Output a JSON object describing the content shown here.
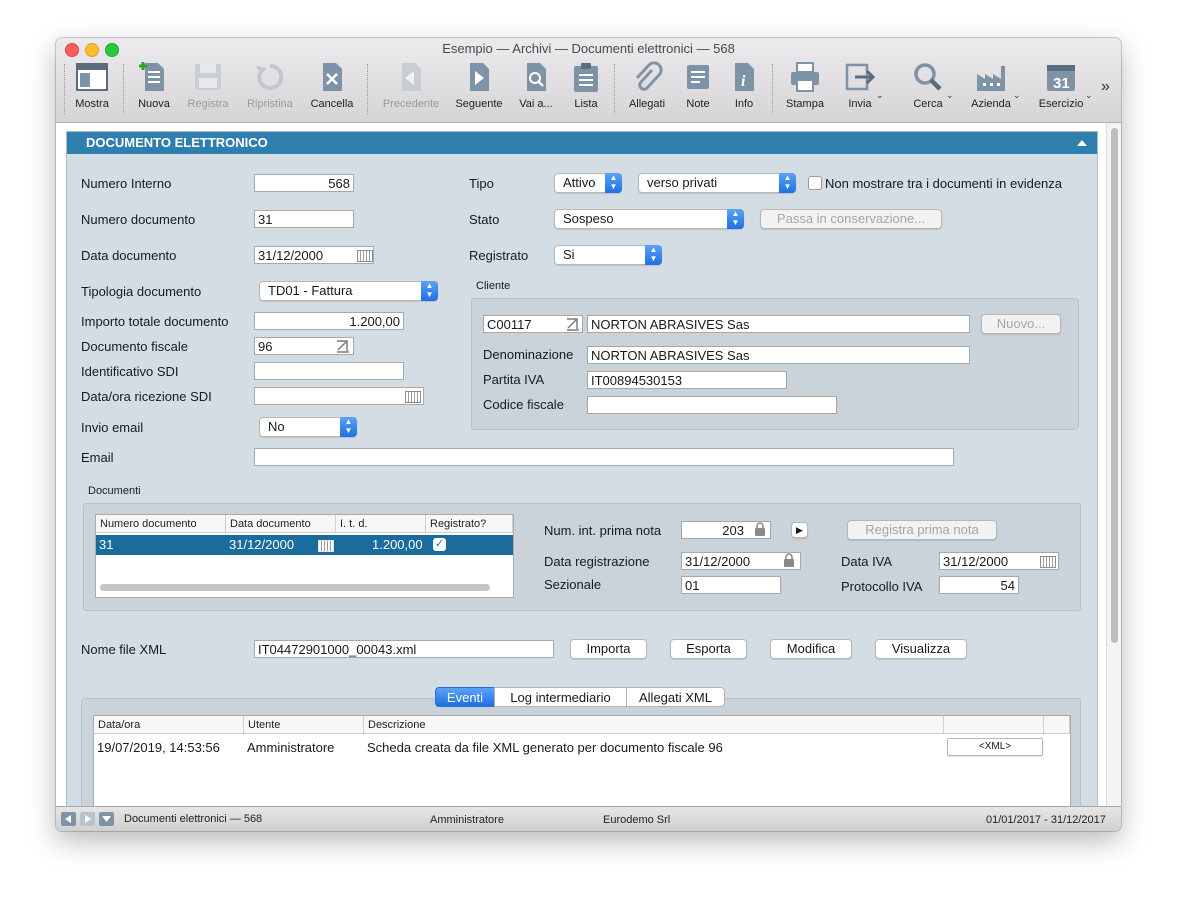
{
  "window": {
    "title": "Esempio — Archivi — Documenti elettronici — 568"
  },
  "toolbar": {
    "mostra": "Mostra",
    "nuova": "Nuova",
    "registra": "Registra",
    "ripristina": "Ripristina",
    "cancella": "Cancella",
    "precedente": "Precedente",
    "seguente": "Seguente",
    "vai": "Vai a...",
    "lista": "Lista",
    "allegati": "Allegati",
    "note": "Note",
    "info": "Info",
    "stampa": "Stampa",
    "invia": "Invia",
    "cerca": "Cerca",
    "azienda": "Azienda",
    "esercizio": "Esercizio",
    "esercizio_day": "31",
    "more": "»"
  },
  "section": {
    "title": "DOCUMENTO ELETTRONICO"
  },
  "form": {
    "numero_interno_label": "Numero Interno",
    "numero_interno": "568",
    "numero_documento_label": "Numero documento",
    "numero_documento": "31",
    "data_documento_label": "Data documento",
    "data_documento": "31/12/2000",
    "tipologia_label": "Tipologia documento",
    "tipologia": "TD01 - Fattura",
    "importo_label": "Importo totale documento",
    "importo": "1.200,00",
    "doc_fiscale_label": "Documento fiscale",
    "doc_fiscale": "96",
    "id_sdi_label": "Identificativo SDI",
    "id_sdi": "",
    "ricezione_sdi_label": "Data/ora ricezione SDI",
    "ricezione_sdi": "",
    "invio_email_label": "Invio email",
    "invio_email": "No",
    "email_label": "Email",
    "email": "",
    "tipo_label": "Tipo",
    "tipo": "Attivo",
    "tipo_dest": "verso privati",
    "non_mostrare_label": "Non mostrare tra i documenti in evidenza",
    "stato_label": "Stato",
    "stato": "Sospeso",
    "conservazione_button": "Passa in conservazione...",
    "registrato_label": "Registrato",
    "registrato": "Si"
  },
  "cliente": {
    "group_label": "Cliente",
    "codice": "C00117",
    "nome": "NORTON ABRASIVES Sas",
    "nuovo_button": "Nuovo...",
    "denominazione_label": "Denominazione",
    "denominazione": "NORTON ABRASIVES Sas",
    "piva_label": "Partita IVA",
    "piva": "IT00894530153",
    "cf_label": "Codice fiscale",
    "cf": ""
  },
  "documenti": {
    "group_label": "Documenti",
    "columns": [
      "Numero documento",
      "Data documento",
      "I. t. d.",
      "Registrato?"
    ],
    "rows": [
      {
        "numero": "31",
        "data": "31/12/2000",
        "importo": "1.200,00",
        "registrato": "✓"
      }
    ]
  },
  "prima_nota": {
    "num_label": "Num. int. prima nota",
    "num": "203",
    "play": "▶",
    "registra_button": "Registra prima nota",
    "data_reg_label": "Data registrazione",
    "data_reg": "31/12/2000",
    "data_iva_label": "Data IVA",
    "data_iva": "31/12/2000",
    "sezionale_label": "Sezionale",
    "sezionale": "01",
    "protocollo_label": "Protocollo IVA",
    "protocollo": "54"
  },
  "xml": {
    "label": "Nome file XML",
    "filename": "IT04472901000_00043.xml",
    "importa": "Importa",
    "esporta": "Esporta",
    "modifica": "Modifica",
    "visualizza": "Visualizza"
  },
  "tabs": [
    "Eventi",
    "Log intermediario",
    "Allegati XML"
  ],
  "eventi": {
    "columns": [
      "Data/ora",
      "Utente",
      "Descrizione"
    ],
    "rows": [
      {
        "data": "19/07/2019, 14:53:56",
        "utente": "Amministratore",
        "descrizione": "Scheda creata da file XML generato per documento fiscale 96",
        "xml_button": "<XML>"
      }
    ]
  },
  "status": {
    "left": "Documenti elettronici — 568",
    "user": "Amministratore",
    "company": "Eurodemo Srl",
    "period": "01/01/2017 - 31/12/2017"
  },
  "colors": {
    "header_blue": "#2e7fad",
    "selection_blue": "#1f6fe3",
    "panel_bg": "#d3dde3"
  }
}
